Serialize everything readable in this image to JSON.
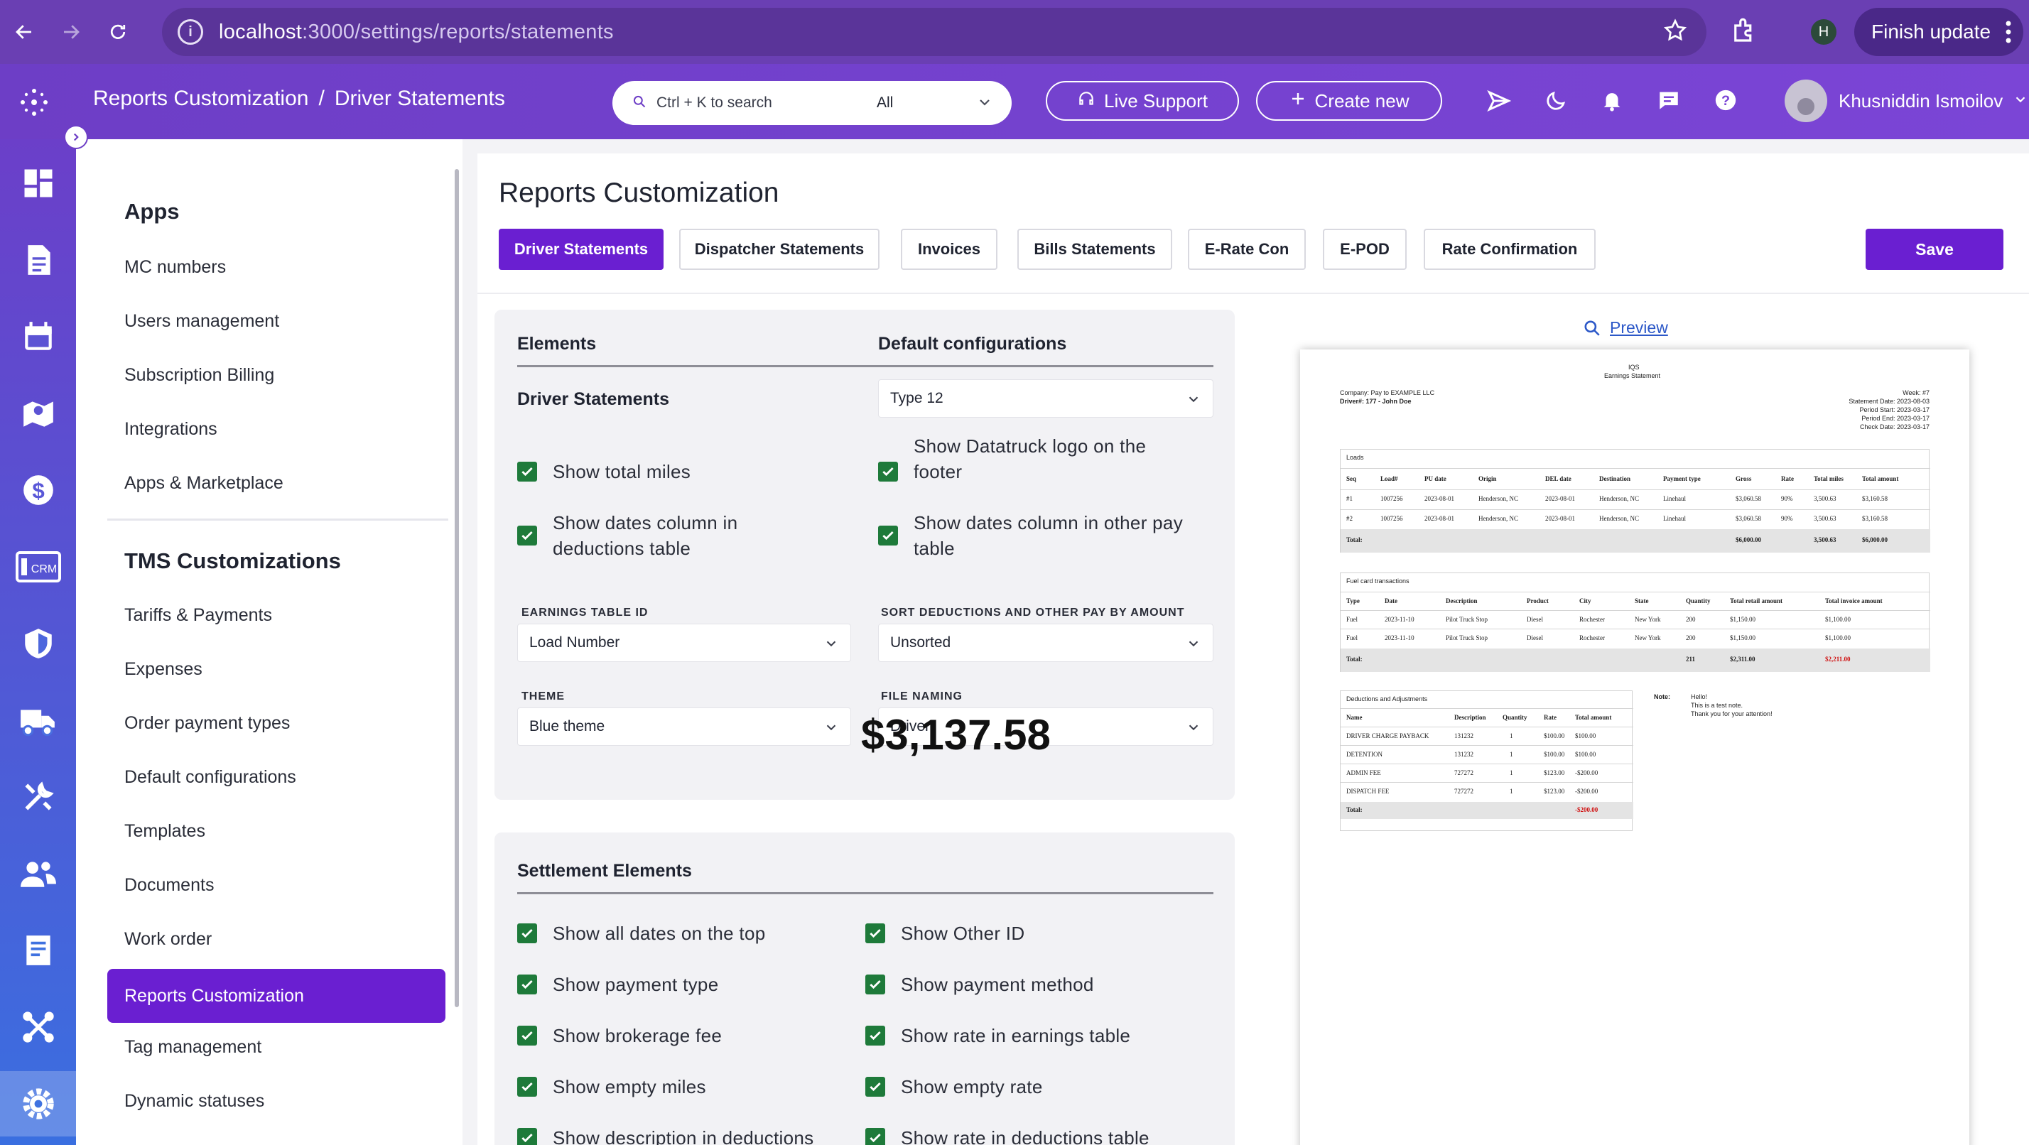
{
  "browser": {
    "url_host": "localhost",
    "url_path": ":3000/settings/reports/statements",
    "profile_initial": "H",
    "finish_update": "Finish update"
  },
  "header": {
    "crumb_parent": "Reports Customization",
    "crumb_sep": "/",
    "crumb_current": "Driver Statements",
    "search_placeholder": "Ctrl + K to search",
    "search_scope": "All",
    "live_support": "Live Support",
    "create_new": "Create new",
    "user_name": "Khusniddin Ismoilov"
  },
  "rail": {
    "crm_label": "CRM"
  },
  "menu": {
    "apps_heading": "Apps",
    "apps_items": [
      "MC numbers",
      "Users management",
      "Subscription Billing",
      "Integrations",
      "Apps & Marketplace"
    ],
    "tms_heading": "TMS Customizations",
    "tms_items": [
      "Tariffs & Payments",
      "Expenses",
      "Order payment types",
      "Default configurations",
      "Templates",
      "Documents",
      "Work order",
      "Reports Customization",
      "Tag management",
      "Dynamic statuses"
    ],
    "active_item": "Reports Customization"
  },
  "main": {
    "title": "Reports Customization",
    "tabs": [
      "Driver Statements",
      "Dispatcher Statements",
      "Invoices",
      "Bills Statements",
      "E-Rate Con",
      "E-POD",
      "Rate Confirmation"
    ],
    "save": "Save"
  },
  "elements_card": {
    "col_elements": "Elements",
    "col_defaults": "Default configurations",
    "row_label": "Driver Statements",
    "type_select": "Type 12",
    "checks": [
      "Show total miles",
      "Show Datatruck logo on the footer",
      "Show dates column in deductions table",
      "Show dates column in other pay table"
    ],
    "earnings_label": "EARNINGS TABLE ID",
    "earnings_value": "Load Number",
    "sort_label": "SORT DEDUCTIONS AND OTHER PAY BY AMOUNT",
    "sort_value": "Unsorted",
    "theme_label": "THEME",
    "theme_value": "Blue theme",
    "file_label": "FILE NAMING",
    "file_value": "Driver"
  },
  "settlement_card": {
    "heading": "Settlement Elements",
    "left": [
      "Show all dates on the top",
      "Show payment type",
      "Show brokerage fee",
      "Show empty miles",
      "Show description in deductions"
    ],
    "right": [
      "Show Other ID",
      "Show payment method",
      "Show rate in earnings table",
      "Show empty rate",
      "Show rate in deductions table"
    ]
  },
  "preview": {
    "link": "Preview",
    "company_code": "IQS",
    "doc_title": "Earnings Statement",
    "company": "Company: Pay to EXAMPLE LLC",
    "driver": "Driver#: 177 - John Doe",
    "week": "Week: #7",
    "statement_date": "Statement Date: 2023-08-03",
    "period_start": "Period Start: 2023-03-17",
    "period_end": "Period End: 2023-03-17",
    "check_date": "Check Date: 2023-03-17",
    "loads_title": "Loads",
    "loads_headers": [
      "Seq",
      "Load#",
      "PU date",
      "Origin",
      "DEL date",
      "Destination",
      "Payment type",
      "Gross",
      "Rate",
      "Total miles",
      "Total amount"
    ],
    "loads_rows": [
      [
        "#1",
        "1007256",
        "2023-08-01",
        "Henderson, NC",
        "2023-08-01",
        "Henderson, NC",
        "Linehaul",
        "$3,060.58",
        "90%",
        "3,500.63",
        "$3,160.58"
      ],
      [
        "#2",
        "1007256",
        "2023-08-01",
        "Henderson, NC",
        "2023-08-01",
        "Henderson, NC",
        "Linehaul",
        "$3,060.58",
        "90%",
        "3,500.63",
        "$3,160.58"
      ]
    ],
    "loads_total": [
      "Total:",
      "$6,000.00",
      "3,500.63",
      "$6,000.00"
    ],
    "fuel_title": "Fuel card transactions",
    "fuel_headers": [
      "Type",
      "Date",
      "Description",
      "Product",
      "City",
      "State",
      "Quantity",
      "Total retail amount",
      "Total invoice amount"
    ],
    "fuel_rows": [
      [
        "Fuel",
        "2023-11-10",
        "Pilot Truck Stop",
        "Diesel",
        "Rochester",
        "New York",
        "200",
        "$1,150.00",
        "$1,100.00"
      ],
      [
        "Fuel",
        "2023-11-10",
        "Pilot Truck Stop",
        "Diesel",
        "Rochester",
        "New York",
        "200",
        "$1,150.00",
        "$1,100.00"
      ]
    ],
    "fuel_total": [
      "Total:",
      "211",
      "$2,311.00",
      "$2,211.00"
    ],
    "ded_title": "Deductions and Adjustments",
    "ded_headers": [
      "Name",
      "Description",
      "Quantity",
      "Rate",
      "Total amount"
    ],
    "ded_rows": [
      [
        "DRIVER CHARGE PAYBACK",
        "131232",
        "1",
        "$100.00",
        "$100.00"
      ],
      [
        "DETENTION",
        "131232",
        "1",
        "$100.00",
        "$100.00"
      ],
      [
        "ADMIN FEE",
        "727272",
        "1",
        "$123.00",
        "-$200.00"
      ],
      [
        "DISPATCH FEE",
        "727272",
        "1",
        "$123.00",
        "-$200.00"
      ]
    ],
    "ded_total": [
      "Total:",
      "-$200.00"
    ],
    "note_label": "Note:",
    "note_lines": [
      "Hello!",
      "This is a test note.",
      "Thank you for your attention!"
    ],
    "grand_total": "$3,137.58"
  }
}
